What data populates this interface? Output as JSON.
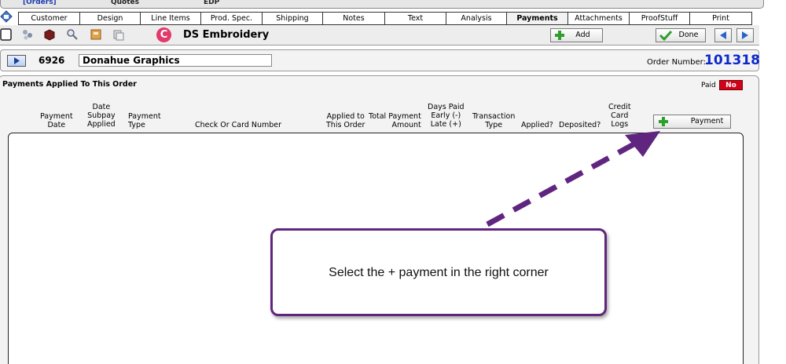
{
  "top_strip": {
    "orders": "[Orders]",
    "quotes": "Quotes",
    "edp": "EDP"
  },
  "tabs": [
    {
      "label": "Customer",
      "active": false
    },
    {
      "label": "Design",
      "active": false
    },
    {
      "label": "Line Items",
      "active": false
    },
    {
      "label": "Prod. Spec.",
      "active": false
    },
    {
      "label": "Shipping",
      "active": false
    },
    {
      "label": "Notes",
      "active": false
    },
    {
      "label": "Text",
      "active": false
    },
    {
      "label": "Analysis",
      "active": false
    },
    {
      "label": "Payments",
      "active": true
    },
    {
      "label": "Attachments",
      "active": false
    },
    {
      "label": "ProofStuff",
      "active": false
    },
    {
      "label": "Print",
      "active": false
    }
  ],
  "toolbar": {
    "company_initial": "C",
    "company_name": "DS Embroidery",
    "add_label": "Add",
    "done_label": "Done",
    "icons": [
      "new-document-icon",
      "network-icon",
      "package-icon",
      "magnify-icon",
      "archive-icon",
      "copy-icon"
    ]
  },
  "customer": {
    "id": "6926",
    "name": "Donahue Graphics"
  },
  "order": {
    "label": "Order Number:",
    "number": "101318"
  },
  "payments": {
    "title": "Payments Applied To This Order",
    "paid_label": "Paid",
    "paid_status": "No",
    "add_payment_label": "Payment",
    "columns": [
      "Payment\nDate",
      "Date\nSubpay\nApplied",
      "Payment\nType",
      "Check Or Card Number",
      "Applied to\nThis Order",
      "Total Payment\nAmount",
      "Days Paid\nEarly (-)\nLate (+)",
      "Transaction\nType",
      "Applied?",
      "Deposited?",
      "Credit\nCard\nLogs"
    ]
  },
  "annotation": {
    "text": "Select the + payment in the right corner"
  },
  "colors": {
    "accent_purple": "#60267f",
    "order_blue": "#0d28c9",
    "status_red": "#d0021b"
  }
}
